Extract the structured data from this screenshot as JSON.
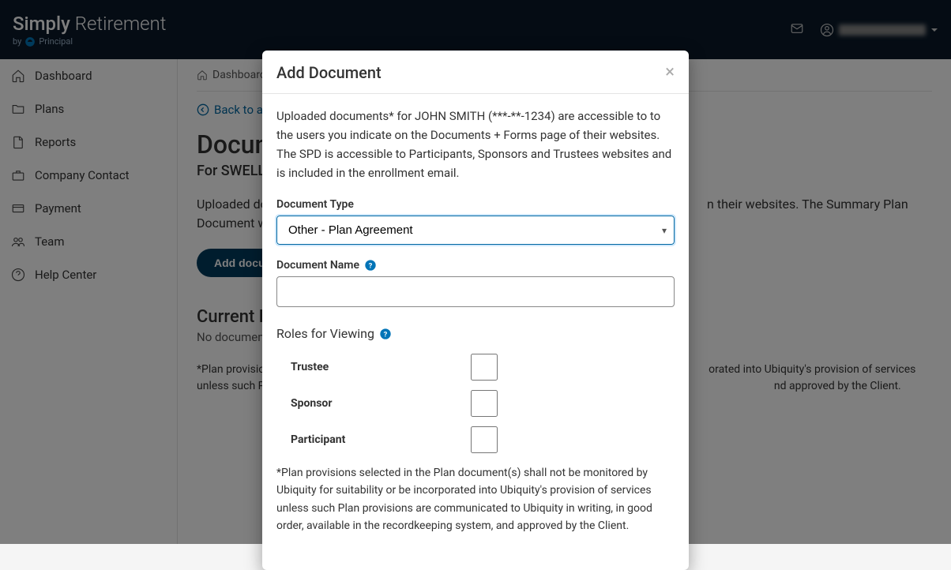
{
  "brand": {
    "name_bold": "Simply",
    "name_rest": " Retirement",
    "byline": "by",
    "partner": "Principal"
  },
  "sidebar": {
    "items": [
      {
        "label": "Dashboard"
      },
      {
        "label": "Plans"
      },
      {
        "label": "Reports"
      },
      {
        "label": "Company Contact"
      },
      {
        "label": "Payment"
      },
      {
        "label": "Team"
      },
      {
        "label": "Help Center"
      }
    ]
  },
  "breadcrumb": {
    "home": "Dashboard"
  },
  "backlink": "Back to all",
  "page": {
    "title_prefix": "Docum",
    "subtitle_prefix": "For SWELL",
    "desc_left": "Uploaded doc",
    "desc_right": "n their websites. The Summary Plan Document will be added t",
    "add_button": "Add document",
    "current_header": "Current Do",
    "nodata": "No documents",
    "disclaimer_left": "*Plan provisions",
    "disclaimer_right1": "orated into Ubiquity's provision of services unless such Plan provisions a",
    "disclaimer_right2": "nd approved by the Client."
  },
  "modal": {
    "title": "Add Document",
    "intro": "Uploaded documents* for JOHN SMITH (***-**-1234) are accessible to to the users you indicate on the Documents + Forms page of their websites. The SPD is accessible to Participants, Sponsors and Trustees websites and is included in the enrollment email.",
    "doc_type_label": "Document Type",
    "doc_type_value": "Other - Plan Agreement",
    "doc_name_label": "Document Name",
    "roles_label": "Roles for Viewing",
    "roles": [
      {
        "label": "Trustee"
      },
      {
        "label": "Sponsor"
      },
      {
        "label": "Participant"
      }
    ],
    "disclaimer": "*Plan provisions selected in the Plan document(s) shall not be monitored by Ubiquity for suitability or be incorporated into Ubiquity's provision of services unless such Plan provisions are communicated to Ubiquity in writing, in good order, available in the recordkeeping system, and approved by the Client."
  }
}
